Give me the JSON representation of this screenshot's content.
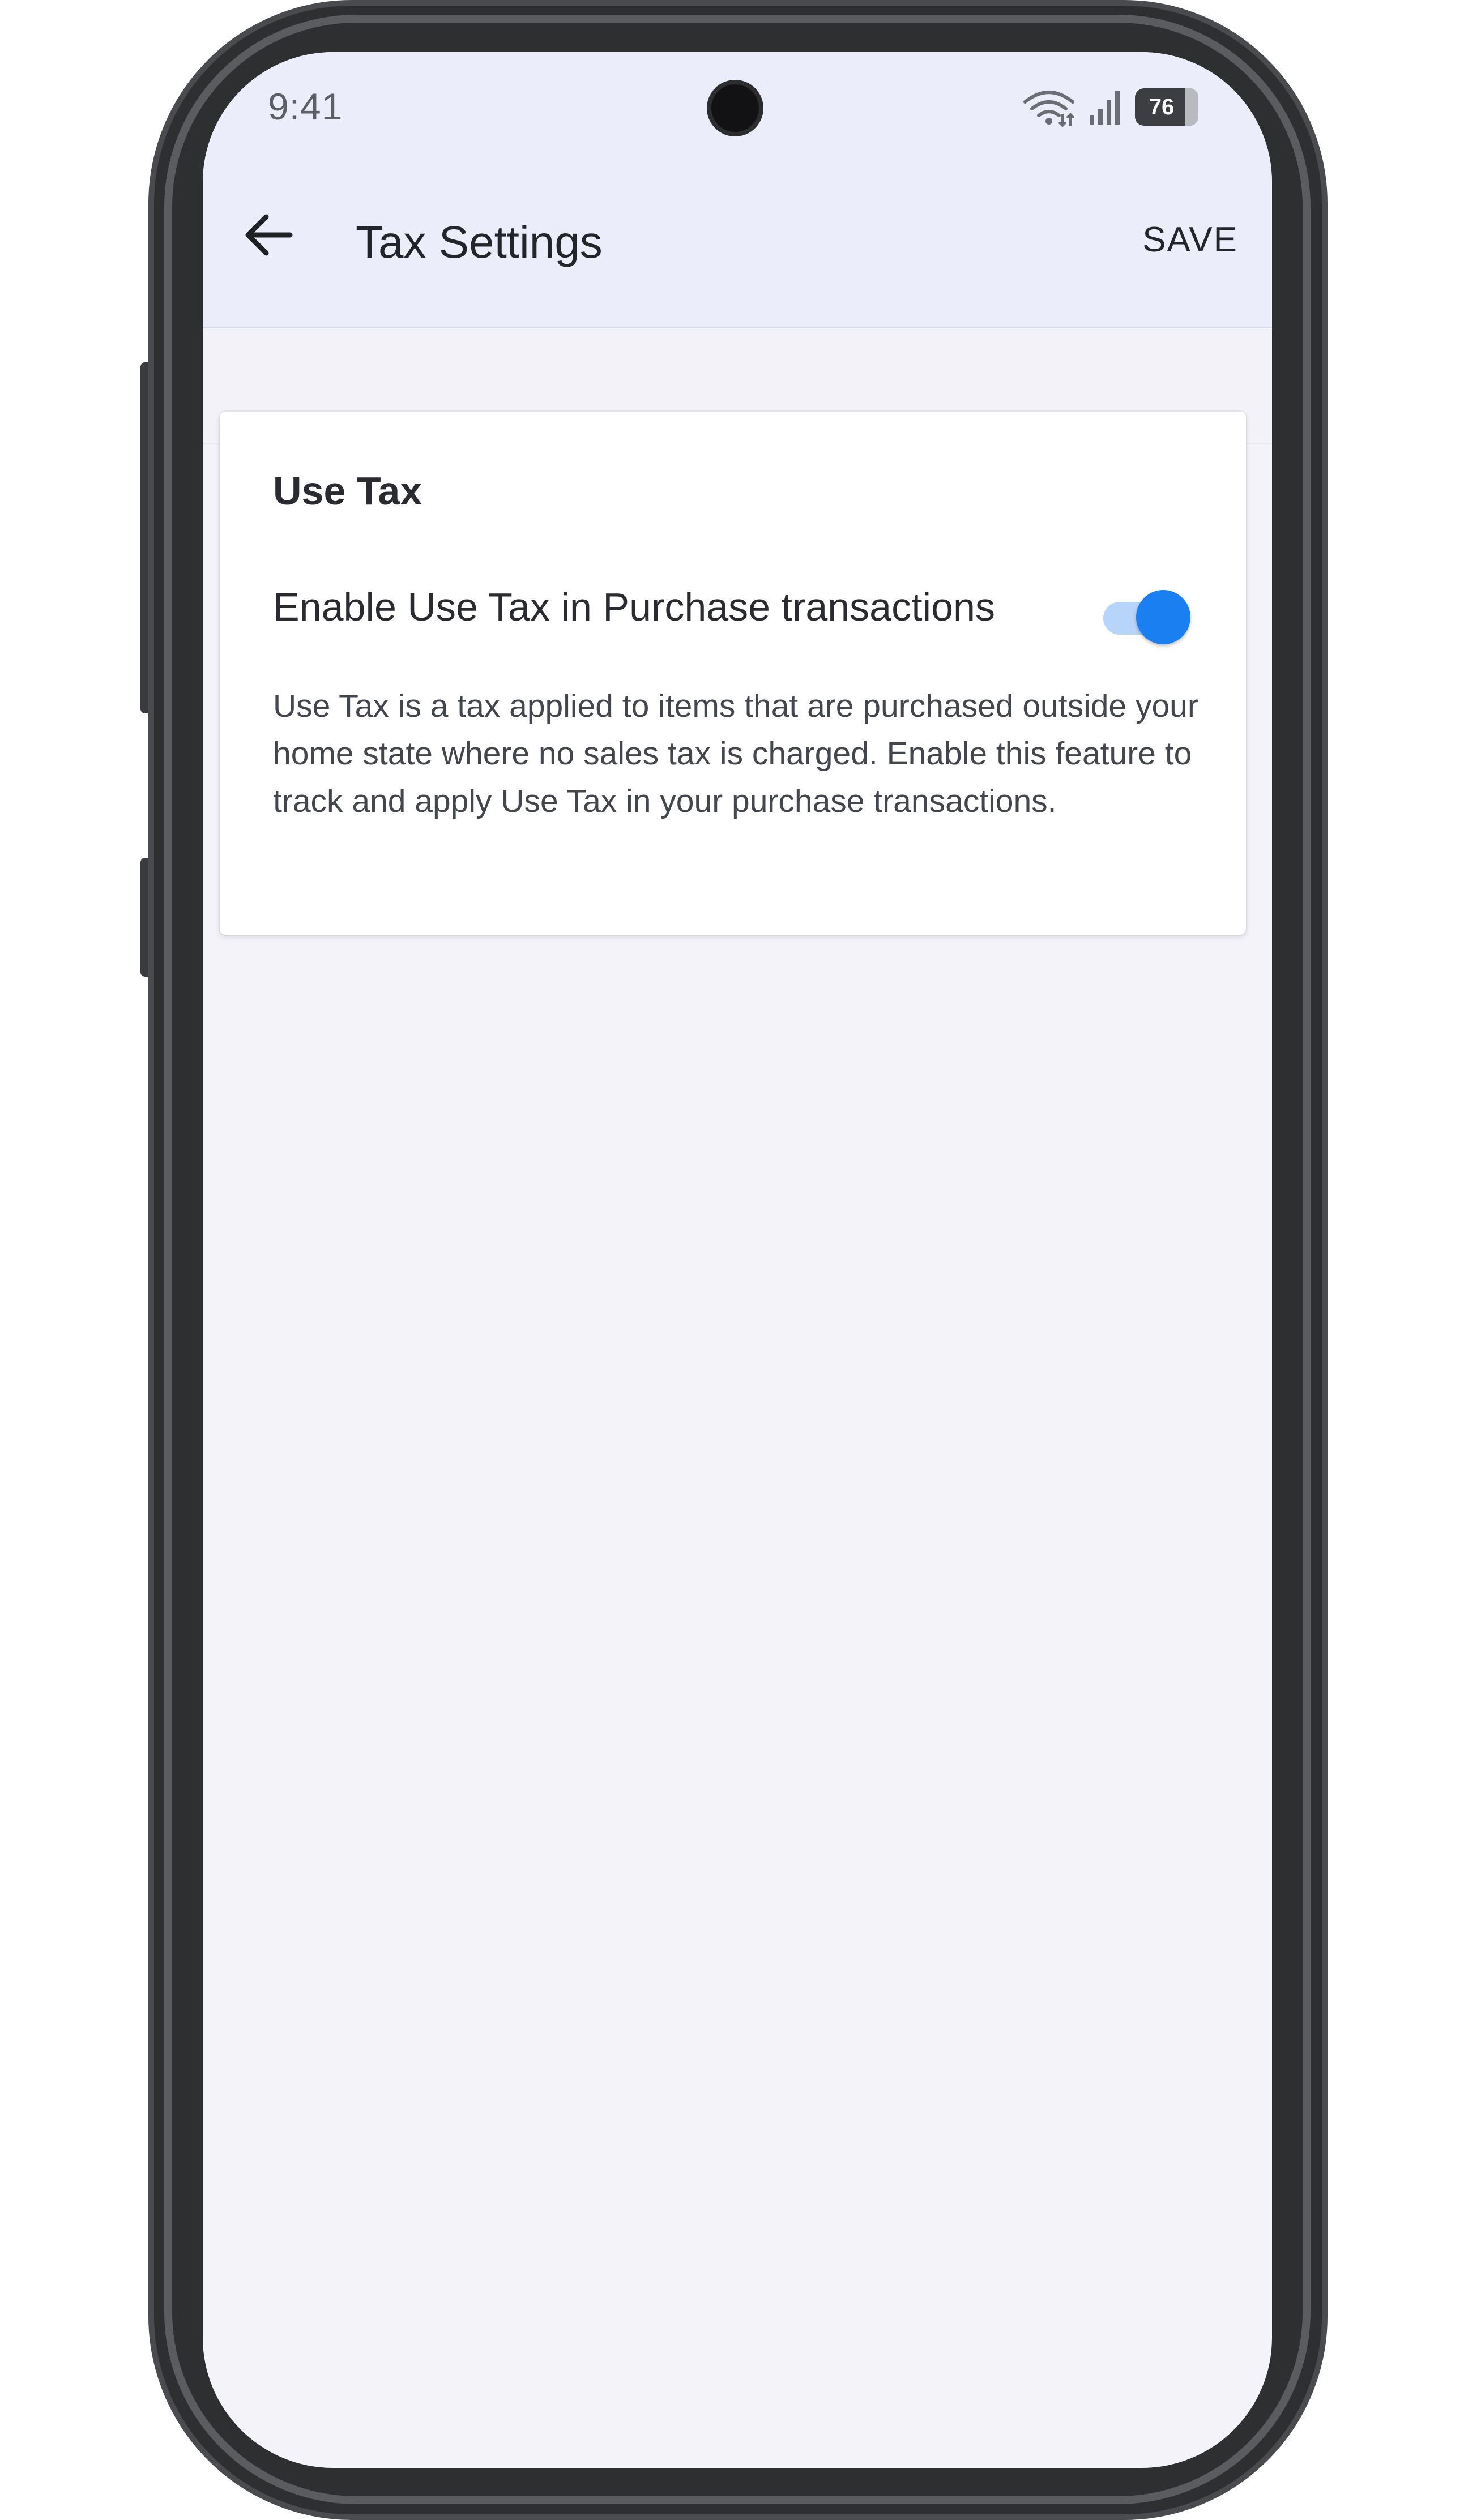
{
  "status_bar": {
    "time": "9:41",
    "battery_level": "76"
  },
  "app_bar": {
    "title": "Tax Settings",
    "save_label": "SAVE"
  },
  "use_tax_card": {
    "title": "Use Tax",
    "toggle_label": "Enable Use Tax in Purchase transactions",
    "toggle_on": true,
    "description": "Use Tax is a tax applied to items that are purchased outside your home state where no sales tax is charged. Enable this feature to track and apply Use Tax in your purchase transactions."
  },
  "colors": {
    "app_bar_bg": "#ebedfb",
    "screen_bg": "#f3f3f9",
    "toggle_accent": "#1a7ff0",
    "toggle_track": "#b7d5fb"
  },
  "icons": {
    "back": "arrow-left-icon",
    "wifi": "wifi-icon",
    "signal": "cellular-signal-icon",
    "battery": "battery-icon"
  }
}
